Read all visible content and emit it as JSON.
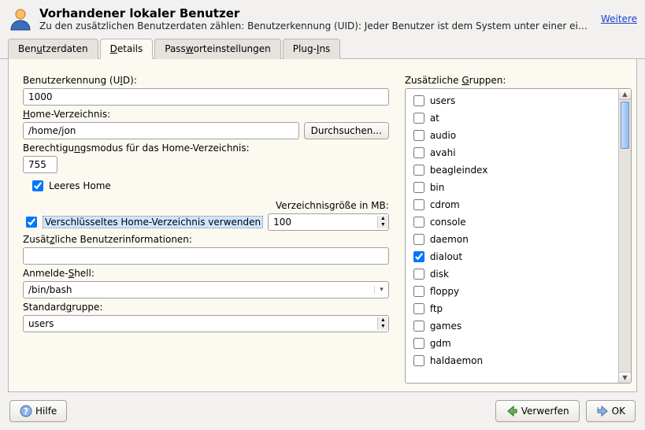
{
  "header": {
    "title": "Vorhandener lokaler Benutzer",
    "description": "Zu den zusätzlichen Benutzerdaten zählen: Benutzerkennung (UID): Jeder Benutzer ist dem System unter einer eindeutig…",
    "more_label": "Weitere"
  },
  "tabs": [
    {
      "label_pre": "Ben",
      "u": "u",
      "label_post": "tzerdaten"
    },
    {
      "label_pre": "",
      "u": "D",
      "label_post": "etails"
    },
    {
      "label_pre": "Pass",
      "u": "w",
      "label_post": "orteinstellungen"
    },
    {
      "label_pre": "Plug-",
      "u": "I",
      "label_post": "ns"
    }
  ],
  "active_tab": 1,
  "uid": {
    "label_pre": "Benutzerkennung (U",
    "u": "I",
    "label_post": "D):",
    "value": "1000"
  },
  "home": {
    "label_pre": "",
    "u": "H",
    "label_post": "ome-Verzeichnis:",
    "value": "/home/jon",
    "browse": "Durchsuchen..."
  },
  "perm": {
    "label_pre": "Berechtigu",
    "u": "n",
    "label_post": "gsmodus für das Home-Verzeichnis:",
    "value": "755"
  },
  "empty_home": {
    "label_pre": "",
    "u": "L",
    "label_post": "eeres Home",
    "checked": true
  },
  "encrypt_home": {
    "label_pre": "Vers",
    "u": "c",
    "label_post": "hlüsseltes Home-Verzeichnis verwenden",
    "checked": true
  },
  "dir_size": {
    "label_pre": "V",
    "u": "e",
    "label_post": "rzeichnisgröße in MB:",
    "value": "100"
  },
  "addinfo": {
    "label_pre": "Zusät",
    "u": "z",
    "label_post": "liche Benutzerinformationen:",
    "value": ""
  },
  "shell": {
    "label_pre": "Anmelde-",
    "u": "S",
    "label_post": "hell:",
    "value": "/bin/bash"
  },
  "defgroup": {
    "label_pre": "Standard",
    "u": "g",
    "label_post": "ruppe:",
    "value": "users"
  },
  "groups_label": {
    "pre": "Zusätzliche ",
    "u": "G",
    "post": "ruppen:"
  },
  "groups": [
    {
      "name": "users",
      "checked": false
    },
    {
      "name": "at",
      "checked": false
    },
    {
      "name": "audio",
      "checked": false
    },
    {
      "name": "avahi",
      "checked": false
    },
    {
      "name": "beagleindex",
      "checked": false
    },
    {
      "name": "bin",
      "checked": false
    },
    {
      "name": "cdrom",
      "checked": false
    },
    {
      "name": "console",
      "checked": false
    },
    {
      "name": "daemon",
      "checked": false
    },
    {
      "name": "dialout",
      "checked": true
    },
    {
      "name": "disk",
      "checked": false
    },
    {
      "name": "floppy",
      "checked": false
    },
    {
      "name": "ftp",
      "checked": false
    },
    {
      "name": "games",
      "checked": false
    },
    {
      "name": "gdm",
      "checked": false
    },
    {
      "name": "haldaemon",
      "checked": false
    }
  ],
  "footer": {
    "help": "Hilfe",
    "discard": "Verwerfen",
    "ok": "OK"
  }
}
